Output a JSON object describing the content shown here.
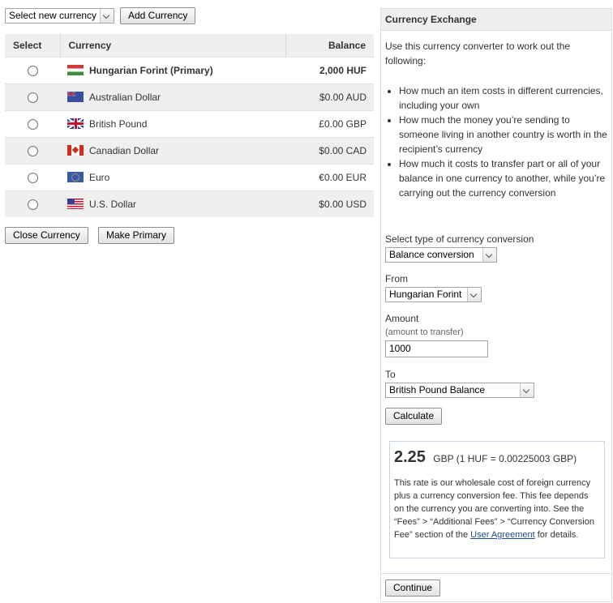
{
  "toolbar": {
    "new_currency_select": "Select new currency",
    "add_currency": "Add Currency"
  },
  "table": {
    "headers": {
      "select": "Select",
      "currency": "Currency",
      "balance": "Balance"
    },
    "rows": [
      {
        "flag": "hungary-flag-icon",
        "currency": "Hungarian Forint (Primary)",
        "balance": "2,000 HUF"
      },
      {
        "flag": "australia-flag-icon",
        "currency": "Australian Dollar",
        "balance": "$0.00 AUD"
      },
      {
        "flag": "uk-flag-icon",
        "currency": "British Pound",
        "balance": "£0.00 GBP"
      },
      {
        "flag": "canada-flag-icon",
        "currency": "Canadian Dollar",
        "balance": "$0.00 CAD"
      },
      {
        "flag": "eu-flag-icon",
        "currency": "Euro",
        "balance": "€0.00 EUR"
      },
      {
        "flag": "us-flag-icon",
        "currency": "U.S. Dollar",
        "balance": "$0.00 USD"
      }
    ]
  },
  "actions": {
    "close_currency": "Close Currency",
    "make_primary": "Make Primary"
  },
  "exchange": {
    "title": "Currency Exchange",
    "intro": "Use this currency converter to work out the following:",
    "bullets": [
      "How much an item costs in different currencies, including your own",
      "How much the money you’re sending to someone living in another country is worth in the recipient’s currency",
      "How much it costs to transfer part or all of your balance in one currency to another, while you’re carrying out the currency conversion"
    ],
    "type_label": "Select type of currency conversion",
    "type_value": "Balance conversion",
    "from_label": "From",
    "from_value": "Hungarian Forint",
    "amount_label": "Amount",
    "amount_hint": "(amount to transfer)",
    "amount_value": "1000",
    "to_label": "To",
    "to_value": "British Pound Balance",
    "calculate": "Calculate",
    "result_value": "2.25",
    "result_rate": "GBP (1 HUF = 0.00225003  GBP)",
    "fine_print_before": "This rate is our wholesale cost of foreign currency plus a currency conversion fee. This fee depends on the currency you are converting into. See the “Fees” > “Additional Fees” > “Currency Conversion Fee” section of the ",
    "fine_print_link": "User Agreement",
    "fine_print_after": " for details.",
    "continue": "Continue"
  }
}
